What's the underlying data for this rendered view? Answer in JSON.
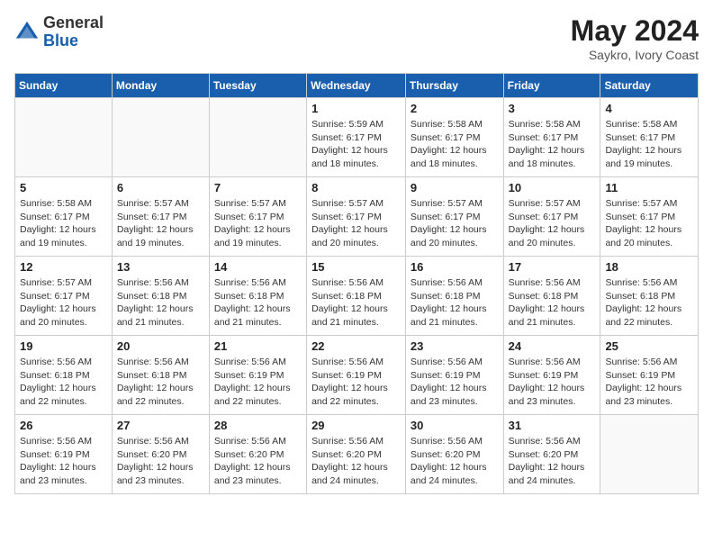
{
  "logo": {
    "general": "General",
    "blue": "Blue"
  },
  "header": {
    "month_year": "May 2024",
    "location": "Saykro, Ivory Coast"
  },
  "weekdays": [
    "Sunday",
    "Monday",
    "Tuesday",
    "Wednesday",
    "Thursday",
    "Friday",
    "Saturday"
  ],
  "weeks": [
    [
      {
        "day": "",
        "sunrise": "",
        "sunset": "",
        "daylight": ""
      },
      {
        "day": "",
        "sunrise": "",
        "sunset": "",
        "daylight": ""
      },
      {
        "day": "",
        "sunrise": "",
        "sunset": "",
        "daylight": ""
      },
      {
        "day": "1",
        "sunrise": "Sunrise: 5:59 AM",
        "sunset": "Sunset: 6:17 PM",
        "daylight": "Daylight: 12 hours and 18 minutes."
      },
      {
        "day": "2",
        "sunrise": "Sunrise: 5:58 AM",
        "sunset": "Sunset: 6:17 PM",
        "daylight": "Daylight: 12 hours and 18 minutes."
      },
      {
        "day": "3",
        "sunrise": "Sunrise: 5:58 AM",
        "sunset": "Sunset: 6:17 PM",
        "daylight": "Daylight: 12 hours and 18 minutes."
      },
      {
        "day": "4",
        "sunrise": "Sunrise: 5:58 AM",
        "sunset": "Sunset: 6:17 PM",
        "daylight": "Daylight: 12 hours and 19 minutes."
      }
    ],
    [
      {
        "day": "5",
        "sunrise": "Sunrise: 5:58 AM",
        "sunset": "Sunset: 6:17 PM",
        "daylight": "Daylight: 12 hours and 19 minutes."
      },
      {
        "day": "6",
        "sunrise": "Sunrise: 5:57 AM",
        "sunset": "Sunset: 6:17 PM",
        "daylight": "Daylight: 12 hours and 19 minutes."
      },
      {
        "day": "7",
        "sunrise": "Sunrise: 5:57 AM",
        "sunset": "Sunset: 6:17 PM",
        "daylight": "Daylight: 12 hours and 19 minutes."
      },
      {
        "day": "8",
        "sunrise": "Sunrise: 5:57 AM",
        "sunset": "Sunset: 6:17 PM",
        "daylight": "Daylight: 12 hours and 20 minutes."
      },
      {
        "day": "9",
        "sunrise": "Sunrise: 5:57 AM",
        "sunset": "Sunset: 6:17 PM",
        "daylight": "Daylight: 12 hours and 20 minutes."
      },
      {
        "day": "10",
        "sunrise": "Sunrise: 5:57 AM",
        "sunset": "Sunset: 6:17 PM",
        "daylight": "Daylight: 12 hours and 20 minutes."
      },
      {
        "day": "11",
        "sunrise": "Sunrise: 5:57 AM",
        "sunset": "Sunset: 6:17 PM",
        "daylight": "Daylight: 12 hours and 20 minutes."
      }
    ],
    [
      {
        "day": "12",
        "sunrise": "Sunrise: 5:57 AM",
        "sunset": "Sunset: 6:17 PM",
        "daylight": "Daylight: 12 hours and 20 minutes."
      },
      {
        "day": "13",
        "sunrise": "Sunrise: 5:56 AM",
        "sunset": "Sunset: 6:18 PM",
        "daylight": "Daylight: 12 hours and 21 minutes."
      },
      {
        "day": "14",
        "sunrise": "Sunrise: 5:56 AM",
        "sunset": "Sunset: 6:18 PM",
        "daylight": "Daylight: 12 hours and 21 minutes."
      },
      {
        "day": "15",
        "sunrise": "Sunrise: 5:56 AM",
        "sunset": "Sunset: 6:18 PM",
        "daylight": "Daylight: 12 hours and 21 minutes."
      },
      {
        "day": "16",
        "sunrise": "Sunrise: 5:56 AM",
        "sunset": "Sunset: 6:18 PM",
        "daylight": "Daylight: 12 hours and 21 minutes."
      },
      {
        "day": "17",
        "sunrise": "Sunrise: 5:56 AM",
        "sunset": "Sunset: 6:18 PM",
        "daylight": "Daylight: 12 hours and 21 minutes."
      },
      {
        "day": "18",
        "sunrise": "Sunrise: 5:56 AM",
        "sunset": "Sunset: 6:18 PM",
        "daylight": "Daylight: 12 hours and 22 minutes."
      }
    ],
    [
      {
        "day": "19",
        "sunrise": "Sunrise: 5:56 AM",
        "sunset": "Sunset: 6:18 PM",
        "daylight": "Daylight: 12 hours and 22 minutes."
      },
      {
        "day": "20",
        "sunrise": "Sunrise: 5:56 AM",
        "sunset": "Sunset: 6:18 PM",
        "daylight": "Daylight: 12 hours and 22 minutes."
      },
      {
        "day": "21",
        "sunrise": "Sunrise: 5:56 AM",
        "sunset": "Sunset: 6:19 PM",
        "daylight": "Daylight: 12 hours and 22 minutes."
      },
      {
        "day": "22",
        "sunrise": "Sunrise: 5:56 AM",
        "sunset": "Sunset: 6:19 PM",
        "daylight": "Daylight: 12 hours and 22 minutes."
      },
      {
        "day": "23",
        "sunrise": "Sunrise: 5:56 AM",
        "sunset": "Sunset: 6:19 PM",
        "daylight": "Daylight: 12 hours and 23 minutes."
      },
      {
        "day": "24",
        "sunrise": "Sunrise: 5:56 AM",
        "sunset": "Sunset: 6:19 PM",
        "daylight": "Daylight: 12 hours and 23 minutes."
      },
      {
        "day": "25",
        "sunrise": "Sunrise: 5:56 AM",
        "sunset": "Sunset: 6:19 PM",
        "daylight": "Daylight: 12 hours and 23 minutes."
      }
    ],
    [
      {
        "day": "26",
        "sunrise": "Sunrise: 5:56 AM",
        "sunset": "Sunset: 6:19 PM",
        "daylight": "Daylight: 12 hours and 23 minutes."
      },
      {
        "day": "27",
        "sunrise": "Sunrise: 5:56 AM",
        "sunset": "Sunset: 6:20 PM",
        "daylight": "Daylight: 12 hours and 23 minutes."
      },
      {
        "day": "28",
        "sunrise": "Sunrise: 5:56 AM",
        "sunset": "Sunset: 6:20 PM",
        "daylight": "Daylight: 12 hours and 23 minutes."
      },
      {
        "day": "29",
        "sunrise": "Sunrise: 5:56 AM",
        "sunset": "Sunset: 6:20 PM",
        "daylight": "Daylight: 12 hours and 24 minutes."
      },
      {
        "day": "30",
        "sunrise": "Sunrise: 5:56 AM",
        "sunset": "Sunset: 6:20 PM",
        "daylight": "Daylight: 12 hours and 24 minutes."
      },
      {
        "day": "31",
        "sunrise": "Sunrise: 5:56 AM",
        "sunset": "Sunset: 6:20 PM",
        "daylight": "Daylight: 12 hours and 24 minutes."
      },
      {
        "day": "",
        "sunrise": "",
        "sunset": "",
        "daylight": ""
      }
    ]
  ]
}
